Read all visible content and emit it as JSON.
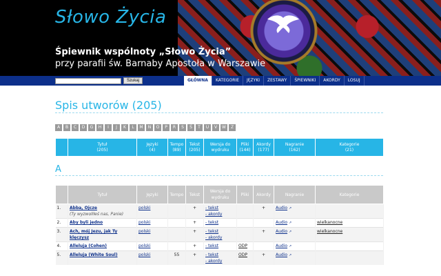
{
  "header": {
    "site_title": "Słowo Życia",
    "subtitle_line1": "Śpiewnik wspólnoty „Słowo Życia”",
    "subtitle_line2": "przy parafii św. Barnaby Apostoła w Warszawie"
  },
  "search": {
    "value": "",
    "button_label": "Szukaj"
  },
  "nav": {
    "tabs": [
      "GŁÓWNA",
      "KATEGORIE",
      "JĘZYKI",
      "ZESTAWY",
      "ŚPIEWNIKI",
      "AKORDY",
      "LOSUJ"
    ],
    "active": "GŁÓWNA"
  },
  "page": {
    "heading": "Spis utworów (205)"
  },
  "letters": [
    "A",
    "B",
    "C",
    "D",
    "G",
    "H",
    "I",
    "J",
    "K",
    "L",
    "M",
    "N",
    "O",
    "P",
    "R",
    "S",
    "Ś",
    "T",
    "U",
    "V",
    "W",
    "Z"
  ],
  "summary_headers": [
    "",
    "Tytuł\n(205)",
    "Języki\n(4)",
    "Tempo\n(89)",
    "Tekst\n(205)",
    "Wersja do\nwydruku",
    "Pliki\n(144)",
    "Akordy\n(177)",
    "Nagranie\n(162)",
    "Kategorie\n(21)"
  ],
  "section": {
    "letter": "A"
  },
  "table_headers": [
    "",
    "Tytuł",
    "Języki",
    "Tempo",
    "Tekst",
    "Wersja do\nwydruku",
    "Pliki",
    "Akordy",
    "Nagranie",
    "Kategorie"
  ],
  "rows": [
    {
      "num": "1.",
      "title": "Abba, Ojcze",
      "subtitle": "(Ty wyzwoliłeś nas, Panie)",
      "lang": "polski",
      "tempo": "",
      "tekst": "+",
      "print": [
        "- tekst",
        "- akordy"
      ],
      "pliki": "",
      "akordy": "+",
      "nagranie": "Audio",
      "kategorie": ""
    },
    {
      "num": "2.",
      "title": "Aby byli jedno",
      "subtitle": "",
      "lang": "polski",
      "tempo": "",
      "tekst": "+",
      "print": [
        "- tekst"
      ],
      "pliki": "",
      "akordy": "",
      "nagranie": "Audio",
      "kategorie": "wielkanocne"
    },
    {
      "num": "3.",
      "title": "Ach, mój Jezu, jak Ty klęczysz",
      "subtitle": "",
      "lang": "polski",
      "tempo": "",
      "tekst": "+",
      "print": [
        "- tekst",
        "- akordy"
      ],
      "pliki": "",
      "akordy": "+",
      "nagranie": "Audio",
      "kategorie": "wielkanocne"
    },
    {
      "num": "4.",
      "title": "Alleluja (Cohen)",
      "subtitle": "",
      "lang": "polski",
      "tempo": "",
      "tekst": "+",
      "print": [
        "- tekst"
      ],
      "pliki": "ODP",
      "akordy": "",
      "nagranie": "Audio",
      "kategorie": ""
    },
    {
      "num": "5.",
      "title": "Alleluja (White Soul)",
      "subtitle": "",
      "lang": "polski",
      "tempo": "55",
      "tekst": "+",
      "print": [
        "- tekst",
        "- akordy"
      ],
      "pliki": "ODP",
      "akordy": "+",
      "nagranie": "Audio",
      "kategorie": ""
    }
  ]
}
